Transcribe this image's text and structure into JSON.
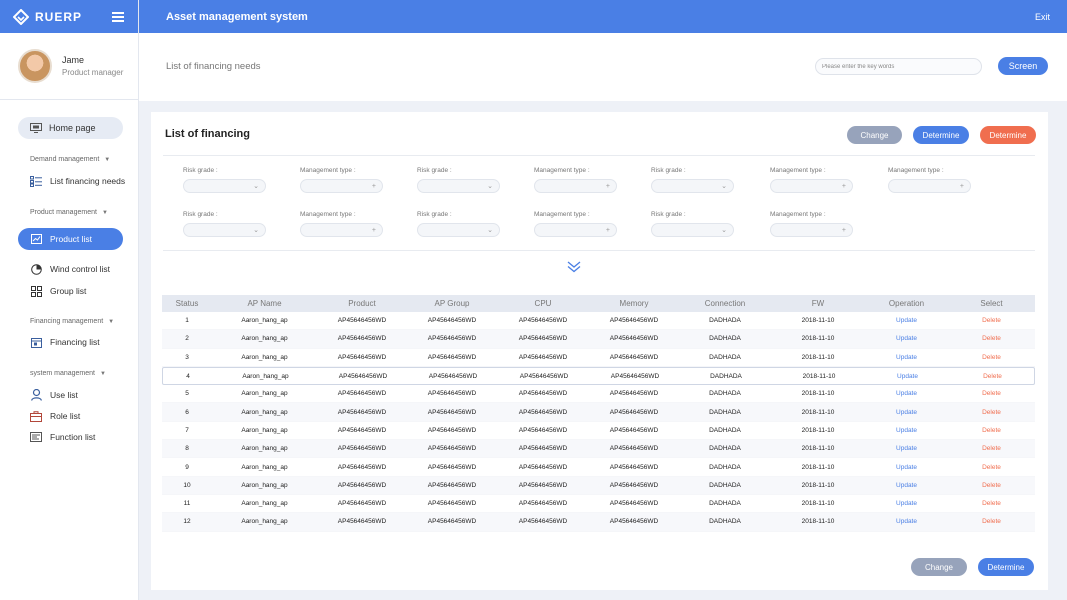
{
  "app": {
    "logo_text": "RUERP",
    "title": "Asset management system",
    "exit_label": "Exit"
  },
  "user": {
    "name": "Jame",
    "role": "Product manager"
  },
  "sidebar": {
    "home_label": "Home page",
    "groups": [
      {
        "title": "Demand management",
        "items": [
          {
            "label": "List financing needs",
            "icon": "list-icon"
          }
        ]
      },
      {
        "title": "Product management",
        "items": [
          {
            "label": "Product list",
            "icon": "chart-icon",
            "active": true
          },
          {
            "label": "Wind control list",
            "icon": "pie-icon"
          },
          {
            "label": "Group list",
            "icon": "grid-icon"
          }
        ]
      },
      {
        "title": "Financing management",
        "items": [
          {
            "label": "Financing list",
            "icon": "calendar-icon"
          }
        ]
      },
      {
        "title": "system  management",
        "items": [
          {
            "label": "Use list",
            "icon": "user-icon"
          },
          {
            "label": "Role list",
            "icon": "role-icon"
          },
          {
            "label": "Function list",
            "icon": "function-icon"
          }
        ]
      }
    ]
  },
  "subheader": {
    "page_title": "List of financing needs",
    "search_placeholder": "Please enter the key words",
    "screen_label": "Screen"
  },
  "card": {
    "title": "List of financing",
    "top_buttons": {
      "change": "Change",
      "determine": "Determine",
      "determine_alt": "Determine"
    },
    "filters_row1": [
      "Risk grade :",
      "Management type :",
      "Risk grade :",
      "Management type :",
      "Risk grade :",
      "Management type :",
      "Management type :"
    ],
    "filters_row2": [
      "Risk grade :",
      "Management type :",
      "Risk grade :",
      "Management type :",
      "Risk grade :",
      "Management type :"
    ],
    "bottom_buttons": {
      "change": "Change",
      "determine": "Determine"
    }
  },
  "table": {
    "columns": [
      "Status",
      "AP Name",
      "Product",
      "AP Group",
      "CPU",
      "Memory",
      "Connection",
      "FW",
      "Operation",
      "Select"
    ],
    "rows": [
      [
        "1",
        "Aaron_hang_ap",
        "AP45646456WD",
        "AP45646456WD",
        "AP45646456WD",
        "AP45646456WD",
        "DADHADA",
        "2018-11-10",
        "Update",
        "Delete"
      ],
      [
        "2",
        "Aaron_hang_ap",
        "AP45646456WD",
        "AP45646456WD",
        "AP45646456WD",
        "AP45646456WD",
        "DADHADA",
        "2018-11-10",
        "Update",
        "Delete"
      ],
      [
        "3",
        "Aaron_hang_ap",
        "AP45646456WD",
        "AP45646456WD",
        "AP45646456WD",
        "AP45646456WD",
        "DADHADA",
        "2018-11-10",
        "Update",
        "Delete"
      ],
      [
        "4",
        "Aaron_hang_ap",
        "AP45646456WD",
        "AP45646456WD",
        "AP45646456WD",
        "AP45646456WD",
        "DADHADA",
        "2018-11-10",
        "Update",
        "Delete"
      ],
      [
        "5",
        "Aaron_hang_ap",
        "AP45646456WD",
        "AP45646456WD",
        "AP45646456WD",
        "AP45646456WD",
        "DADHADA",
        "2018-11-10",
        "Update",
        "Delete"
      ],
      [
        "6",
        "Aaron_hang_ap",
        "AP45646456WD",
        "AP45646456WD",
        "AP45646456WD",
        "AP45646456WD",
        "DADHADA",
        "2018-11-10",
        "Update",
        "Delete"
      ],
      [
        "7",
        "Aaron_hang_ap",
        "AP45646456WD",
        "AP45646456WD",
        "AP45646456WD",
        "AP45646456WD",
        "DADHADA",
        "2018-11-10",
        "Update",
        "Delete"
      ],
      [
        "8",
        "Aaron_hang_ap",
        "AP45646456WD",
        "AP45646456WD",
        "AP45646456WD",
        "AP45646456WD",
        "DADHADA",
        "2018-11-10",
        "Update",
        "Delete"
      ],
      [
        "9",
        "Aaron_hang_ap",
        "AP45646456WD",
        "AP45646456WD",
        "AP45646456WD",
        "AP45646456WD",
        "DADHADA",
        "2018-11-10",
        "Update",
        "Delete"
      ],
      [
        "10",
        "Aaron_hang_ap",
        "AP45646456WD",
        "AP45646456WD",
        "AP45646456WD",
        "AP45646456WD",
        "DADHADA",
        "2018-11-10",
        "Update",
        "Delete"
      ],
      [
        "11",
        "Aaron_hang_ap",
        "AP45646456WD",
        "AP45646456WD",
        "AP45646456WD",
        "AP45646456WD",
        "DADHADA",
        "2018-11-10",
        "Update",
        "Delete"
      ],
      [
        "12",
        "Aaron_hang_ap",
        "AP45646456WD",
        "AP45646456WD",
        "AP45646456WD",
        "AP45646456WD",
        "DADHADA",
        "2018-11-10",
        "Update",
        "Delete"
      ]
    ],
    "highlighted_row": 4
  },
  "colors": {
    "accent": "#4a7fe5",
    "danger": "#f06e4f",
    "muted_button": "#97a3bb"
  }
}
